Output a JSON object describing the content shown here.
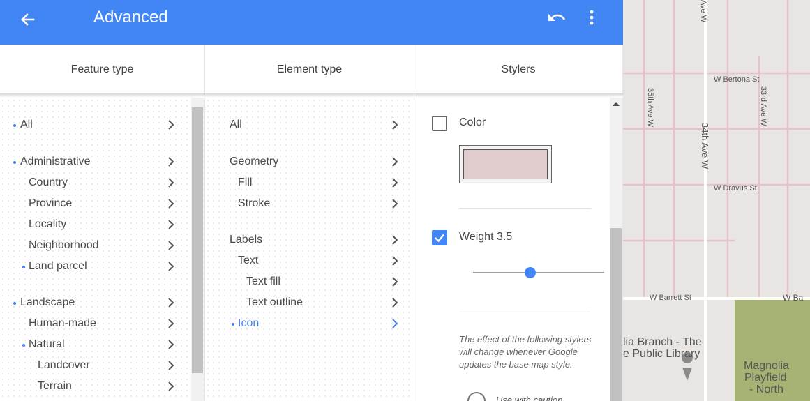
{
  "header": {
    "title": "Advanced",
    "back_icon": "arrow-back-icon",
    "undo_icon": "undo-icon",
    "more_icon": "more-vert-icon",
    "color": "#4285f4"
  },
  "columns": {
    "feature": "Feature type",
    "element": "Element type",
    "stylers": "Stylers"
  },
  "feature_types": [
    {
      "label": "All",
      "dot": true
    },
    {
      "label": "Administrative",
      "dot": true
    },
    {
      "label": "Country",
      "dot": false
    },
    {
      "label": "Province",
      "dot": false
    },
    {
      "label": "Locality",
      "dot": false
    },
    {
      "label": "Neighborhood",
      "dot": false
    },
    {
      "label": "Land parcel",
      "dot": true
    },
    {
      "label": "Landscape",
      "dot": true
    },
    {
      "label": "Human-made",
      "dot": false
    },
    {
      "label": "Natural",
      "dot": true
    },
    {
      "label": "Landcover",
      "dot": false
    },
    {
      "label": "Terrain",
      "dot": false
    }
  ],
  "element_types": [
    {
      "label": "All"
    },
    {
      "label": "Geometry"
    },
    {
      "label": "Fill"
    },
    {
      "label": "Stroke"
    },
    {
      "label": "Labels"
    },
    {
      "label": "Text"
    },
    {
      "label": "Text fill"
    },
    {
      "label": "Text outline"
    },
    {
      "label": "Icon",
      "selected": true
    }
  ],
  "stylers": {
    "color_label": "Color",
    "color_checked": false,
    "swatch_color": "#e0cccc",
    "weight_label": "Weight 3.5",
    "weight_checked": true,
    "weight_value": 3.5,
    "note": "The effect of the following stylers will change whenever Google updates the base map style.",
    "caution": "Use with caution"
  },
  "map": {
    "streets": [
      "Ave W",
      "W Bertona St",
      "35th Ave W",
      "33rd Ave W",
      "34th Ave W",
      "W Dravus St",
      "W Barrett St",
      "W Ba"
    ],
    "places": [
      "lia Branch - The",
      "e Public Library",
      "Magnolia",
      "Playfield",
      "- North"
    ],
    "park_color": "#a5b374",
    "road_color": "#e6c3cb"
  }
}
